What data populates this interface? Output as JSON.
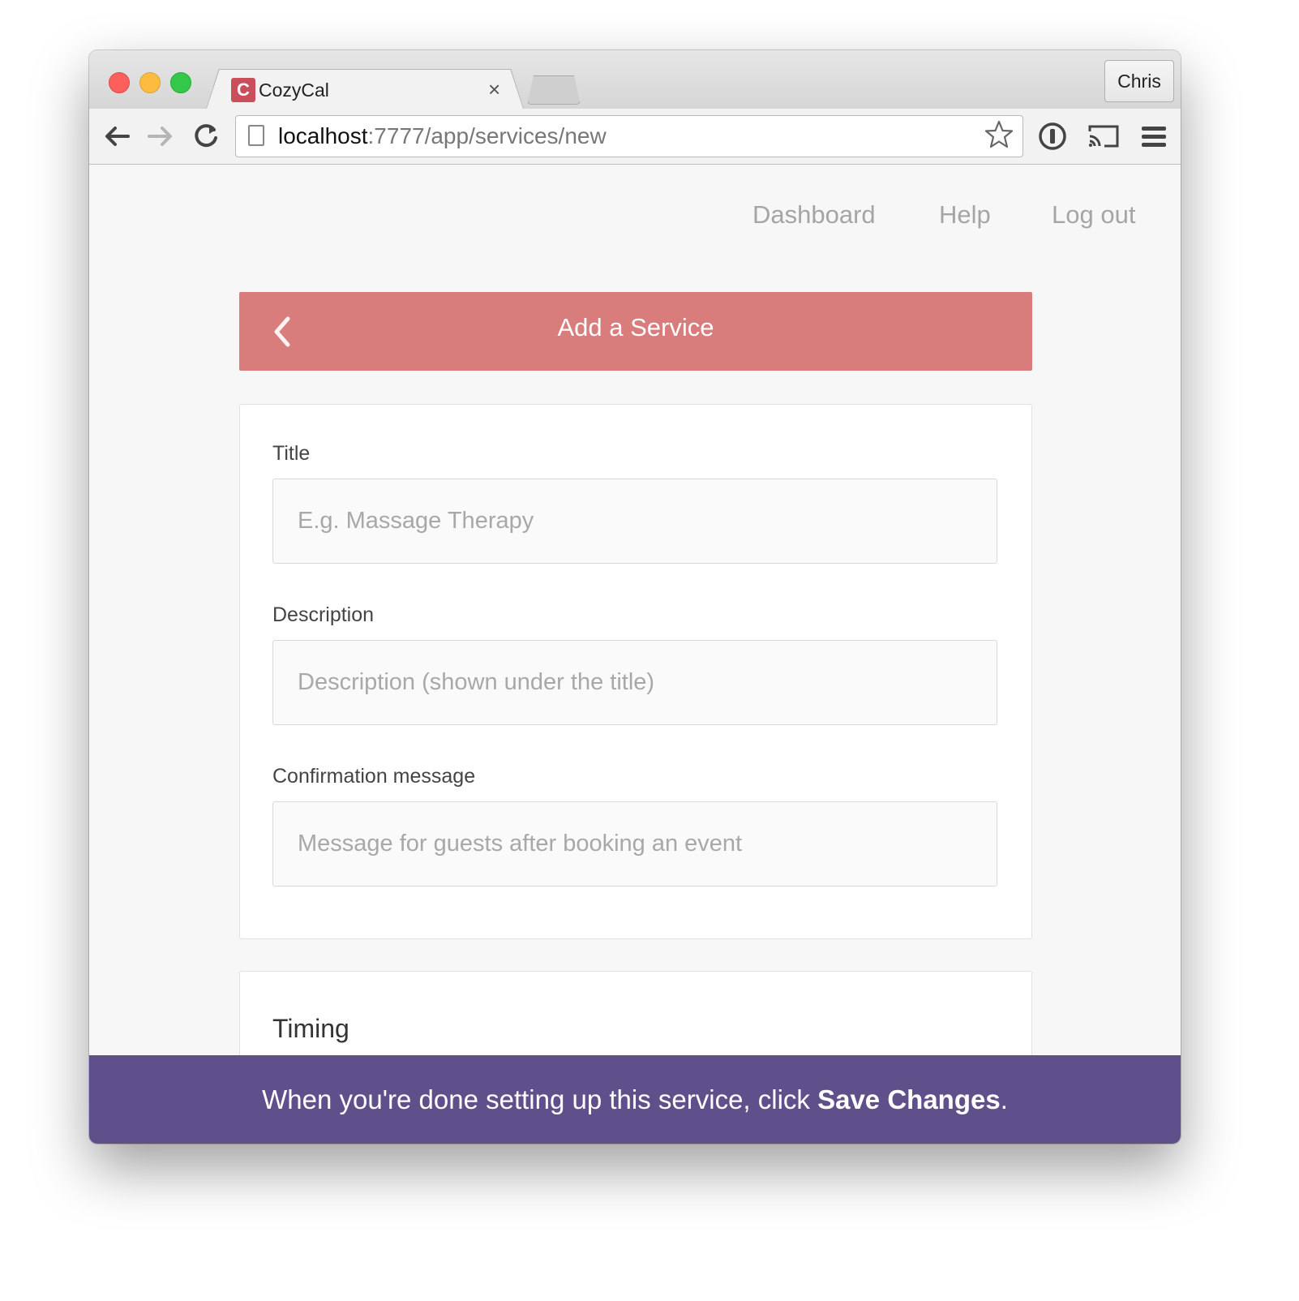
{
  "browser": {
    "tab": {
      "favicon_letter": "C",
      "title": "CozyCal",
      "close": "×"
    },
    "profile": "Chris",
    "url": {
      "host": "localhost",
      "rest": ":7777/app/services/new"
    }
  },
  "nav": {
    "links": [
      "Dashboard",
      "Help",
      "Log out"
    ]
  },
  "header": {
    "title": "Add a Service",
    "color": "#d97c7c"
  },
  "form": {
    "title_label": "Title",
    "title_placeholder": "E.g. Massage Therapy",
    "description_label": "Description",
    "description_placeholder": "Description (shown under the title)",
    "confirmation_label": "Confirmation message",
    "confirmation_placeholder": "Message for guests after booking an event"
  },
  "timing": {
    "title": "Timing"
  },
  "banner": {
    "text": "When you're done setting up this service, click ",
    "emphasis": "Save Changes",
    "end": ".",
    "color": "#5f4f8b"
  },
  "icons": [
    "back-arrow-icon",
    "forward-arrow-icon",
    "reload-icon",
    "page-icon",
    "star-icon",
    "password-manager-icon",
    "cast-icon",
    "menu-icon",
    "chevron-left-icon"
  ]
}
